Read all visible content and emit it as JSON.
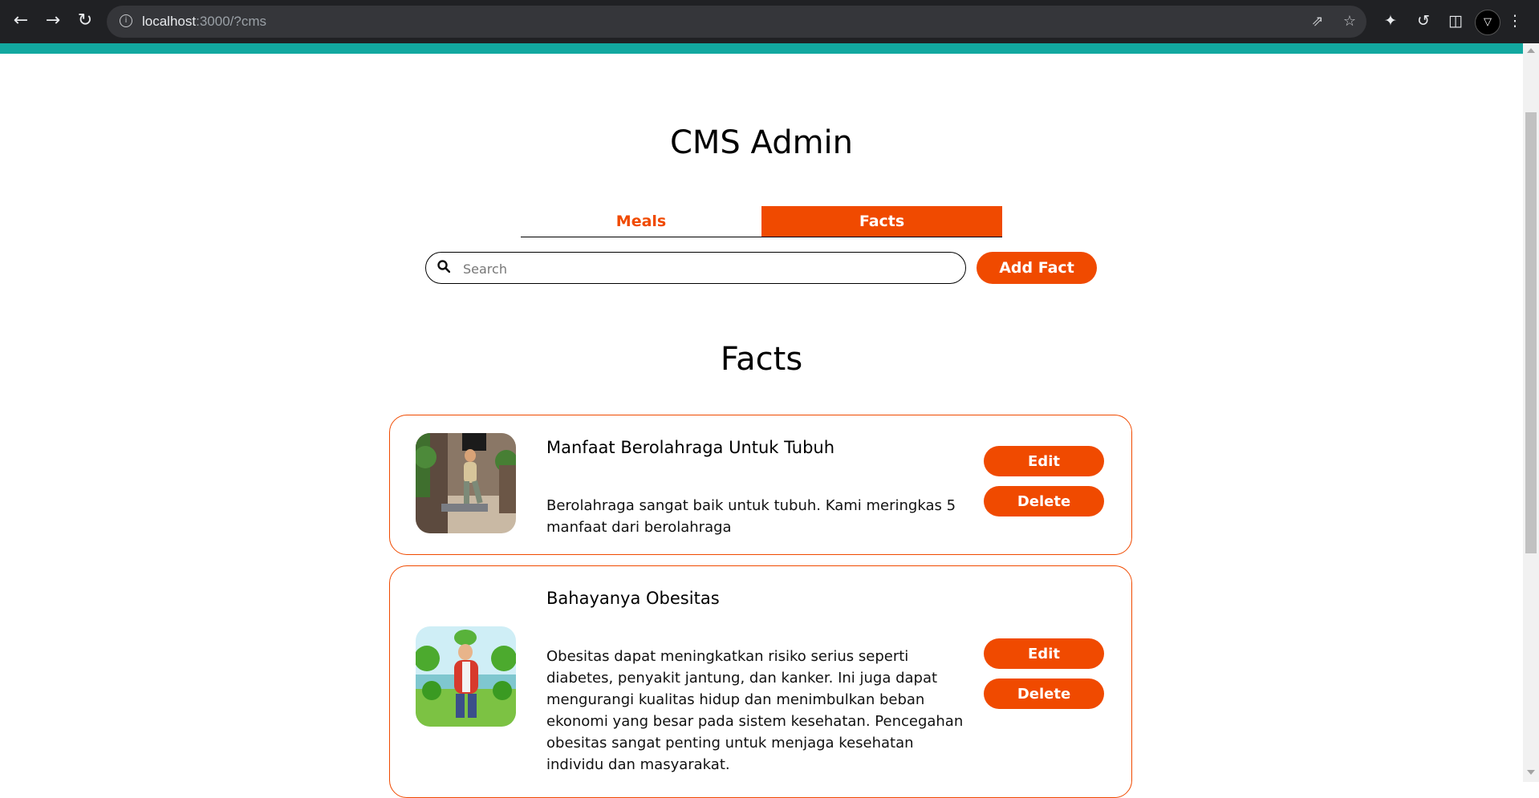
{
  "browser": {
    "url_host": "localhost",
    "url_rest": ":3000/?cms",
    "profile_initial": "▽"
  },
  "header": {
    "title": "CMS Admin"
  },
  "tabs": [
    {
      "label": "Meals",
      "active": false
    },
    {
      "label": "Facts",
      "active": true
    }
  ],
  "search": {
    "placeholder": "Search",
    "value": ""
  },
  "add_button": "Add Fact",
  "section_title": "Facts",
  "facts": [
    {
      "title": "Manfaat Berolahraga Untuk Tubuh",
      "description": "Berolahraga sangat baik untuk tubuh. Kami meringkas 5 manfaat dari berolahraga",
      "edit_label": "Edit",
      "delete_label": "Delete"
    },
    {
      "title": "Bahayanya Obesitas",
      "description": "Obesitas dapat meningkatkan risiko serius seperti diabetes, penyakit jantung, dan kanker. Ini juga dapat mengurangi kualitas hidup dan menimbulkan beban ekonomi yang besar pada sistem kesehatan. Pencegahan obesitas sangat penting untuk menjaga kesehatan individu dan masyarakat.",
      "edit_label": "Edit",
      "delete_label": "Delete"
    }
  ],
  "colors": {
    "accent": "#f04a00",
    "top_bar": "#12a8a0",
    "chrome": "#202124"
  }
}
